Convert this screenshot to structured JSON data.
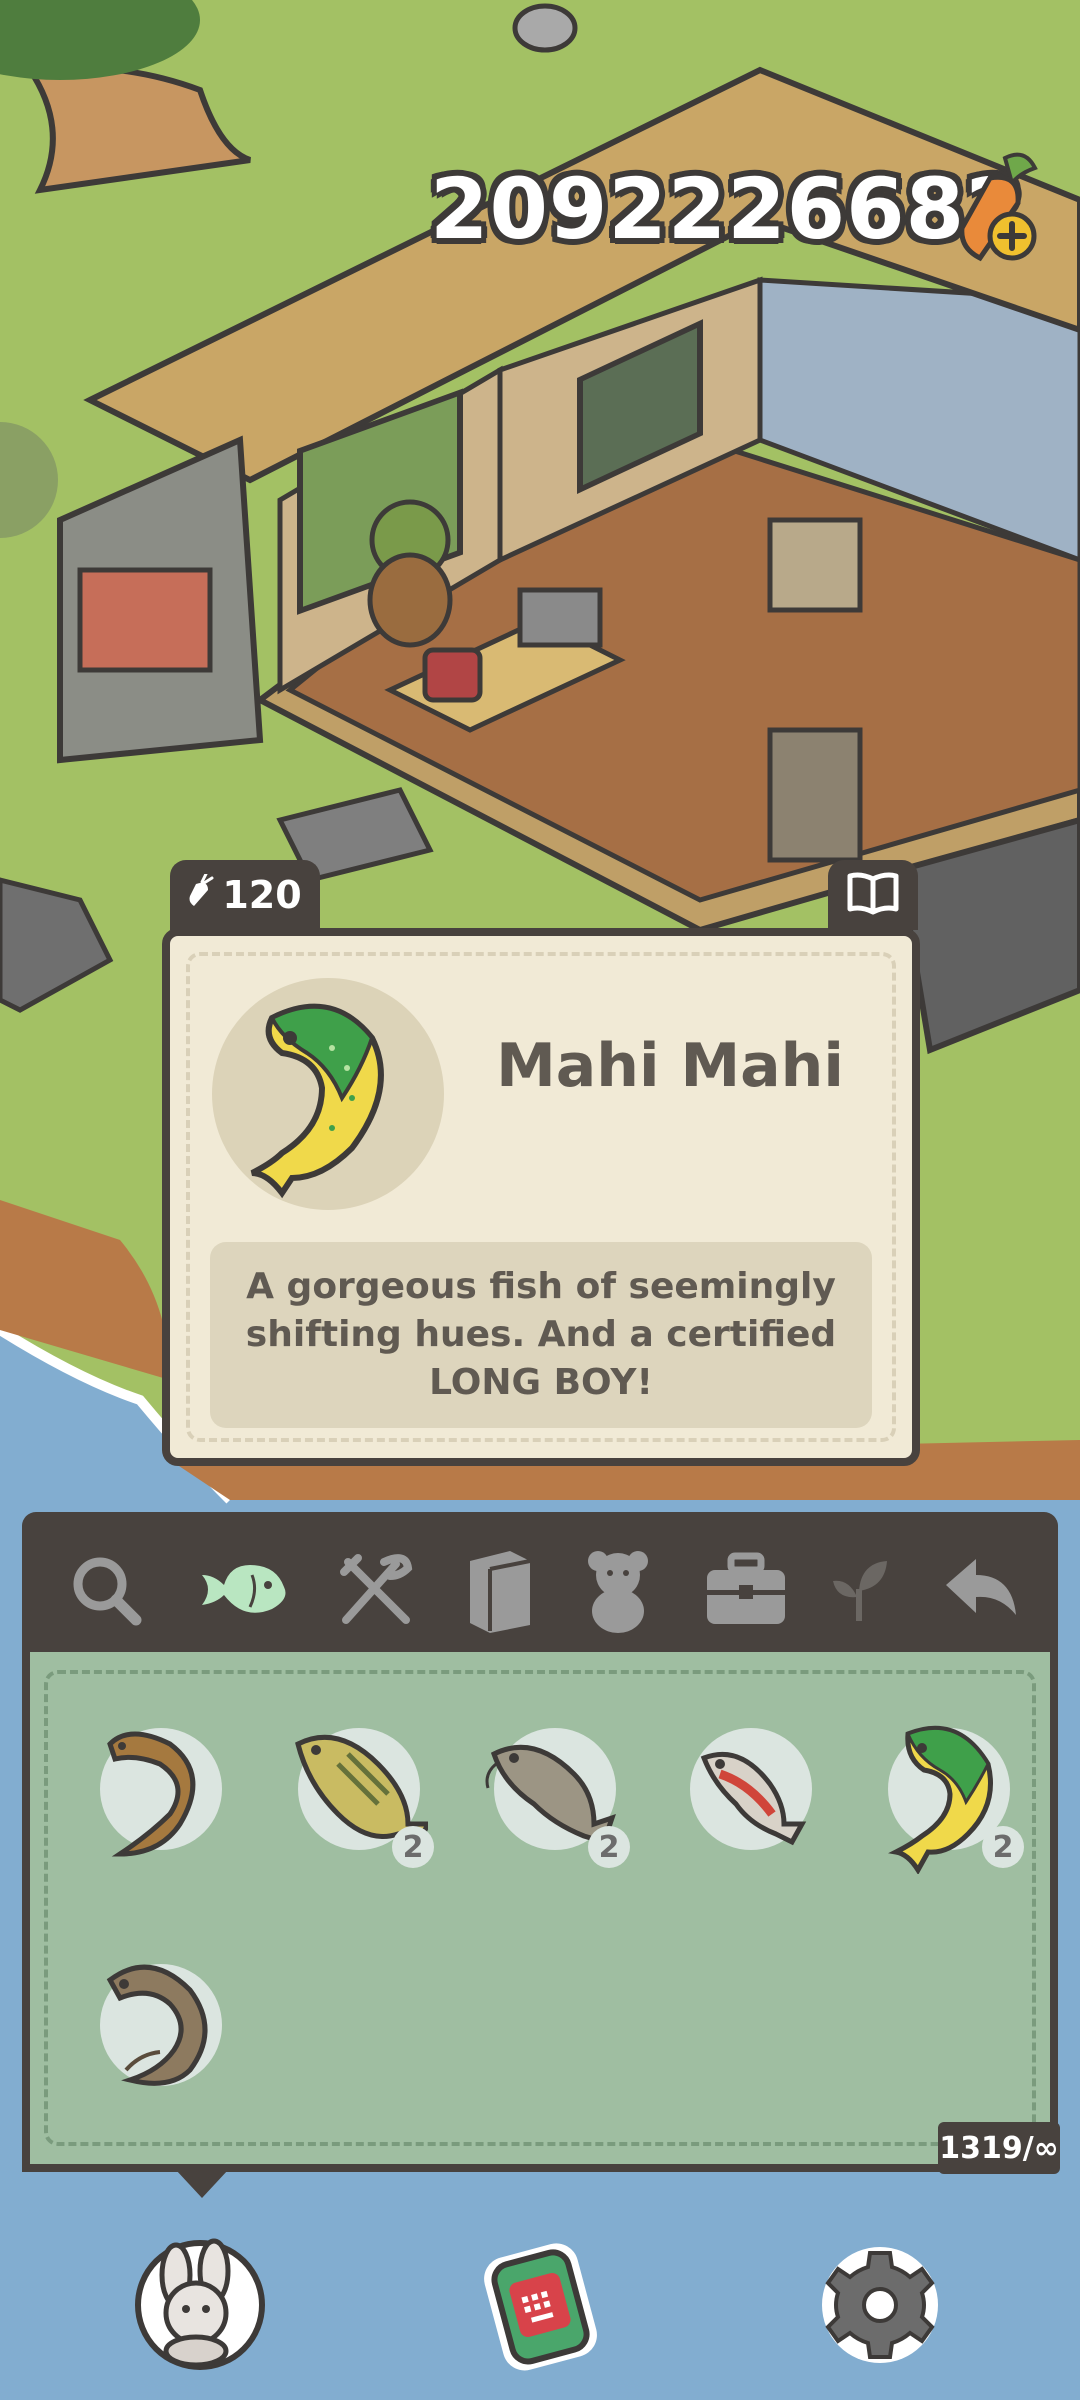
{
  "currency": {
    "amount": "2092226682",
    "icon": "carrot-plus-icon"
  },
  "item_card": {
    "price": "120",
    "price_icon": "carrot-icon",
    "journal_icon": "book-icon",
    "name": "Mahi Mahi",
    "description": "A gorgeous fish of seemingly shifting hues. And a certified LONG BOY!",
    "colors": {
      "card_bg": "#f1ead6",
      "border": "#48423e",
      "text": "#605a52"
    }
  },
  "inventory": {
    "tabs": [
      {
        "icon": "search-icon",
        "active": false
      },
      {
        "icon": "fish-icon",
        "active": true
      },
      {
        "icon": "fork-knife-icon",
        "active": false
      },
      {
        "icon": "book-icon",
        "active": false
      },
      {
        "icon": "teddy-bear-icon",
        "active": false
      },
      {
        "icon": "toolbox-icon",
        "active": false
      },
      {
        "icon": "sprout-icon",
        "active": false
      },
      {
        "icon": "back-arrow-icon",
        "active": false
      }
    ],
    "items": [
      {
        "icon": "eel-icon",
        "quantity": ""
      },
      {
        "icon": "bass-icon",
        "quantity": "2"
      },
      {
        "icon": "catfish-icon",
        "quantity": "2"
      },
      {
        "icon": "red-fish-icon",
        "quantity": ""
      },
      {
        "icon": "mahi-mahi-icon",
        "quantity": "2"
      },
      {
        "icon": "lamprey-icon",
        "quantity": ""
      }
    ],
    "capacity": "1319/∞",
    "colors": {
      "panel_bg": "#9fbea1",
      "active_tab": "#b9e6c1"
    }
  },
  "bottom_nav": [
    {
      "icon": "bunny-character-icon"
    },
    {
      "icon": "phone-icon"
    },
    {
      "icon": "settings-gear-icon"
    }
  ]
}
